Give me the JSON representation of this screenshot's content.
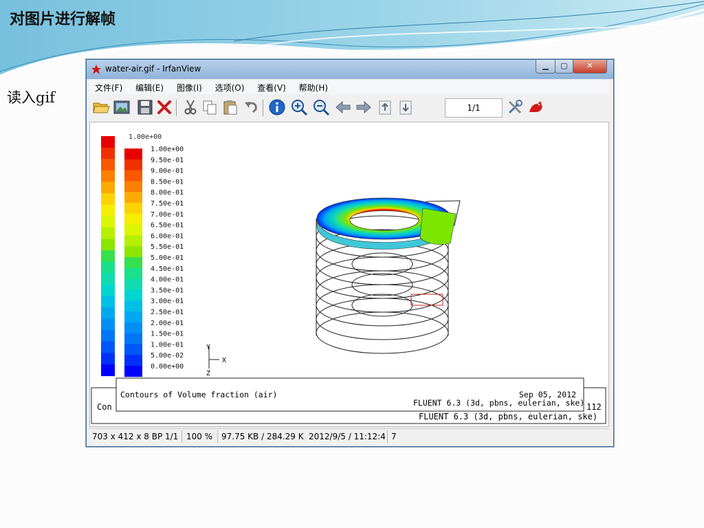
{
  "slide": {
    "title": "对图片进行解帧",
    "side_text": "读入gif"
  },
  "window": {
    "title": "water-air.gif - IrfanView",
    "controls": {
      "minimize": "▁",
      "maximize": "▢",
      "close": "✕"
    }
  },
  "menu": [
    "文件(F)",
    "编辑(E)",
    "图像(I)",
    "选项(O)",
    "查看(V)",
    "帮助(H)"
  ],
  "toolbar": {
    "buttons": [
      "open-folder-icon",
      "slideshow-icon",
      "save-icon",
      "delete-icon",
      "cut-icon",
      "copy-icon",
      "paste-icon",
      "undo-icon",
      "info-icon",
      "zoom-in-icon",
      "zoom-out-icon",
      "previous-arrow-icon",
      "next-arrow-icon",
      "first-page-icon",
      "last-page-icon",
      "settings-icon",
      "irfanview-logo-icon"
    ],
    "page_value": "1/1"
  },
  "image": {
    "legend_ticks_front": [
      "1.00e+00",
      "9.50e-01",
      "9.00e-01",
      "8.50e-01",
      "8.00e-01",
      "7.50e-01",
      "7.00e-01",
      "6.50e-01",
      "6.00e-01",
      "5.50e-01",
      "5.00e-01",
      "4.50e-01",
      "4.00e-01",
      "3.50e-01",
      "3.00e-01",
      "2.50e-01",
      "2.00e-01",
      "1.50e-01",
      "1.00e-01",
      "5.00e-02",
      "0.00e+00"
    ],
    "legend_partial_top": "1.00e+00",
    "legend_colors": [
      "#e80000",
      "#f03000",
      "#f85800",
      "#fb8000",
      "#fcaa00",
      "#fcd200",
      "#f6ee00",
      "#dcf600",
      "#b4f000",
      "#8ce600",
      "#36e04c",
      "#18e08c",
      "#10dcb0",
      "#00d6d0",
      "#00c0e8",
      "#00a8f0",
      "#0090f4",
      "#0076f6",
      "#0056f8",
      "#0030fc",
      "#0000ff"
    ],
    "axis_y": "Y",
    "axis_x": "X",
    "axis_z": "Z",
    "caption_front": "Contours of Volume fraction (air)",
    "date_front": "Sep 05, 2012",
    "solver_front": "FLUENT 6.3 (3d, pbns, eulerian, ske)",
    "caption_back_partial": "Con",
    "date_back_partial": "112",
    "solver_back": "FLUENT 6.3 (3d, pbns, eulerian, ske)"
  },
  "status": {
    "dimensions": "703 x 412 x 8 BP",
    "page": "1/1",
    "zoom": "100 %",
    "size": "97.75 KB / 284.29 K",
    "timestamp": "2012/9/5 / 11:12:4",
    "extra": "7"
  }
}
